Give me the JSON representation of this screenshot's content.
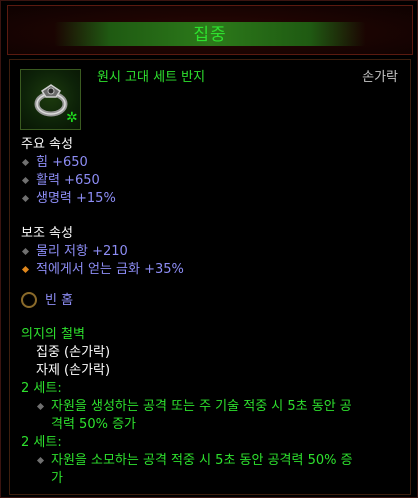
{
  "title": "집중",
  "item": {
    "name": "원시 고대 세트 반지",
    "slot": "손가락",
    "icon": "ring-icon"
  },
  "primary": {
    "header": "주요 속성",
    "stats": [
      "힘 +650",
      "활력 +650",
      "생명력 +15%"
    ]
  },
  "secondary": {
    "header": "보조 속성",
    "stats": [
      "물리 저항 +210",
      "적에게서 얻는 금화 +35%"
    ]
  },
  "socket": {
    "label": "빈 홈"
  },
  "set": {
    "name": "의지의 철벽",
    "items": [
      "집중 (손가락)",
      "자제 (손가락)"
    ],
    "bonuses": [
      {
        "header": "2 세트:",
        "lines": [
          "자원을 생성하는 공격 또는 주 기술 적중 시 5초 동안 공",
          "격력 50% 증가"
        ]
      },
      {
        "header": "2 세트:",
        "lines": [
          "자원을 소모하는 공격 적중 시 5초 동안 공격력 50% 증",
          "가"
        ]
      }
    ]
  },
  "colors": {
    "set_green": "#2ee12e",
    "stat_blue": "#8d8df5",
    "bullet_orange": "#e0871c"
  }
}
